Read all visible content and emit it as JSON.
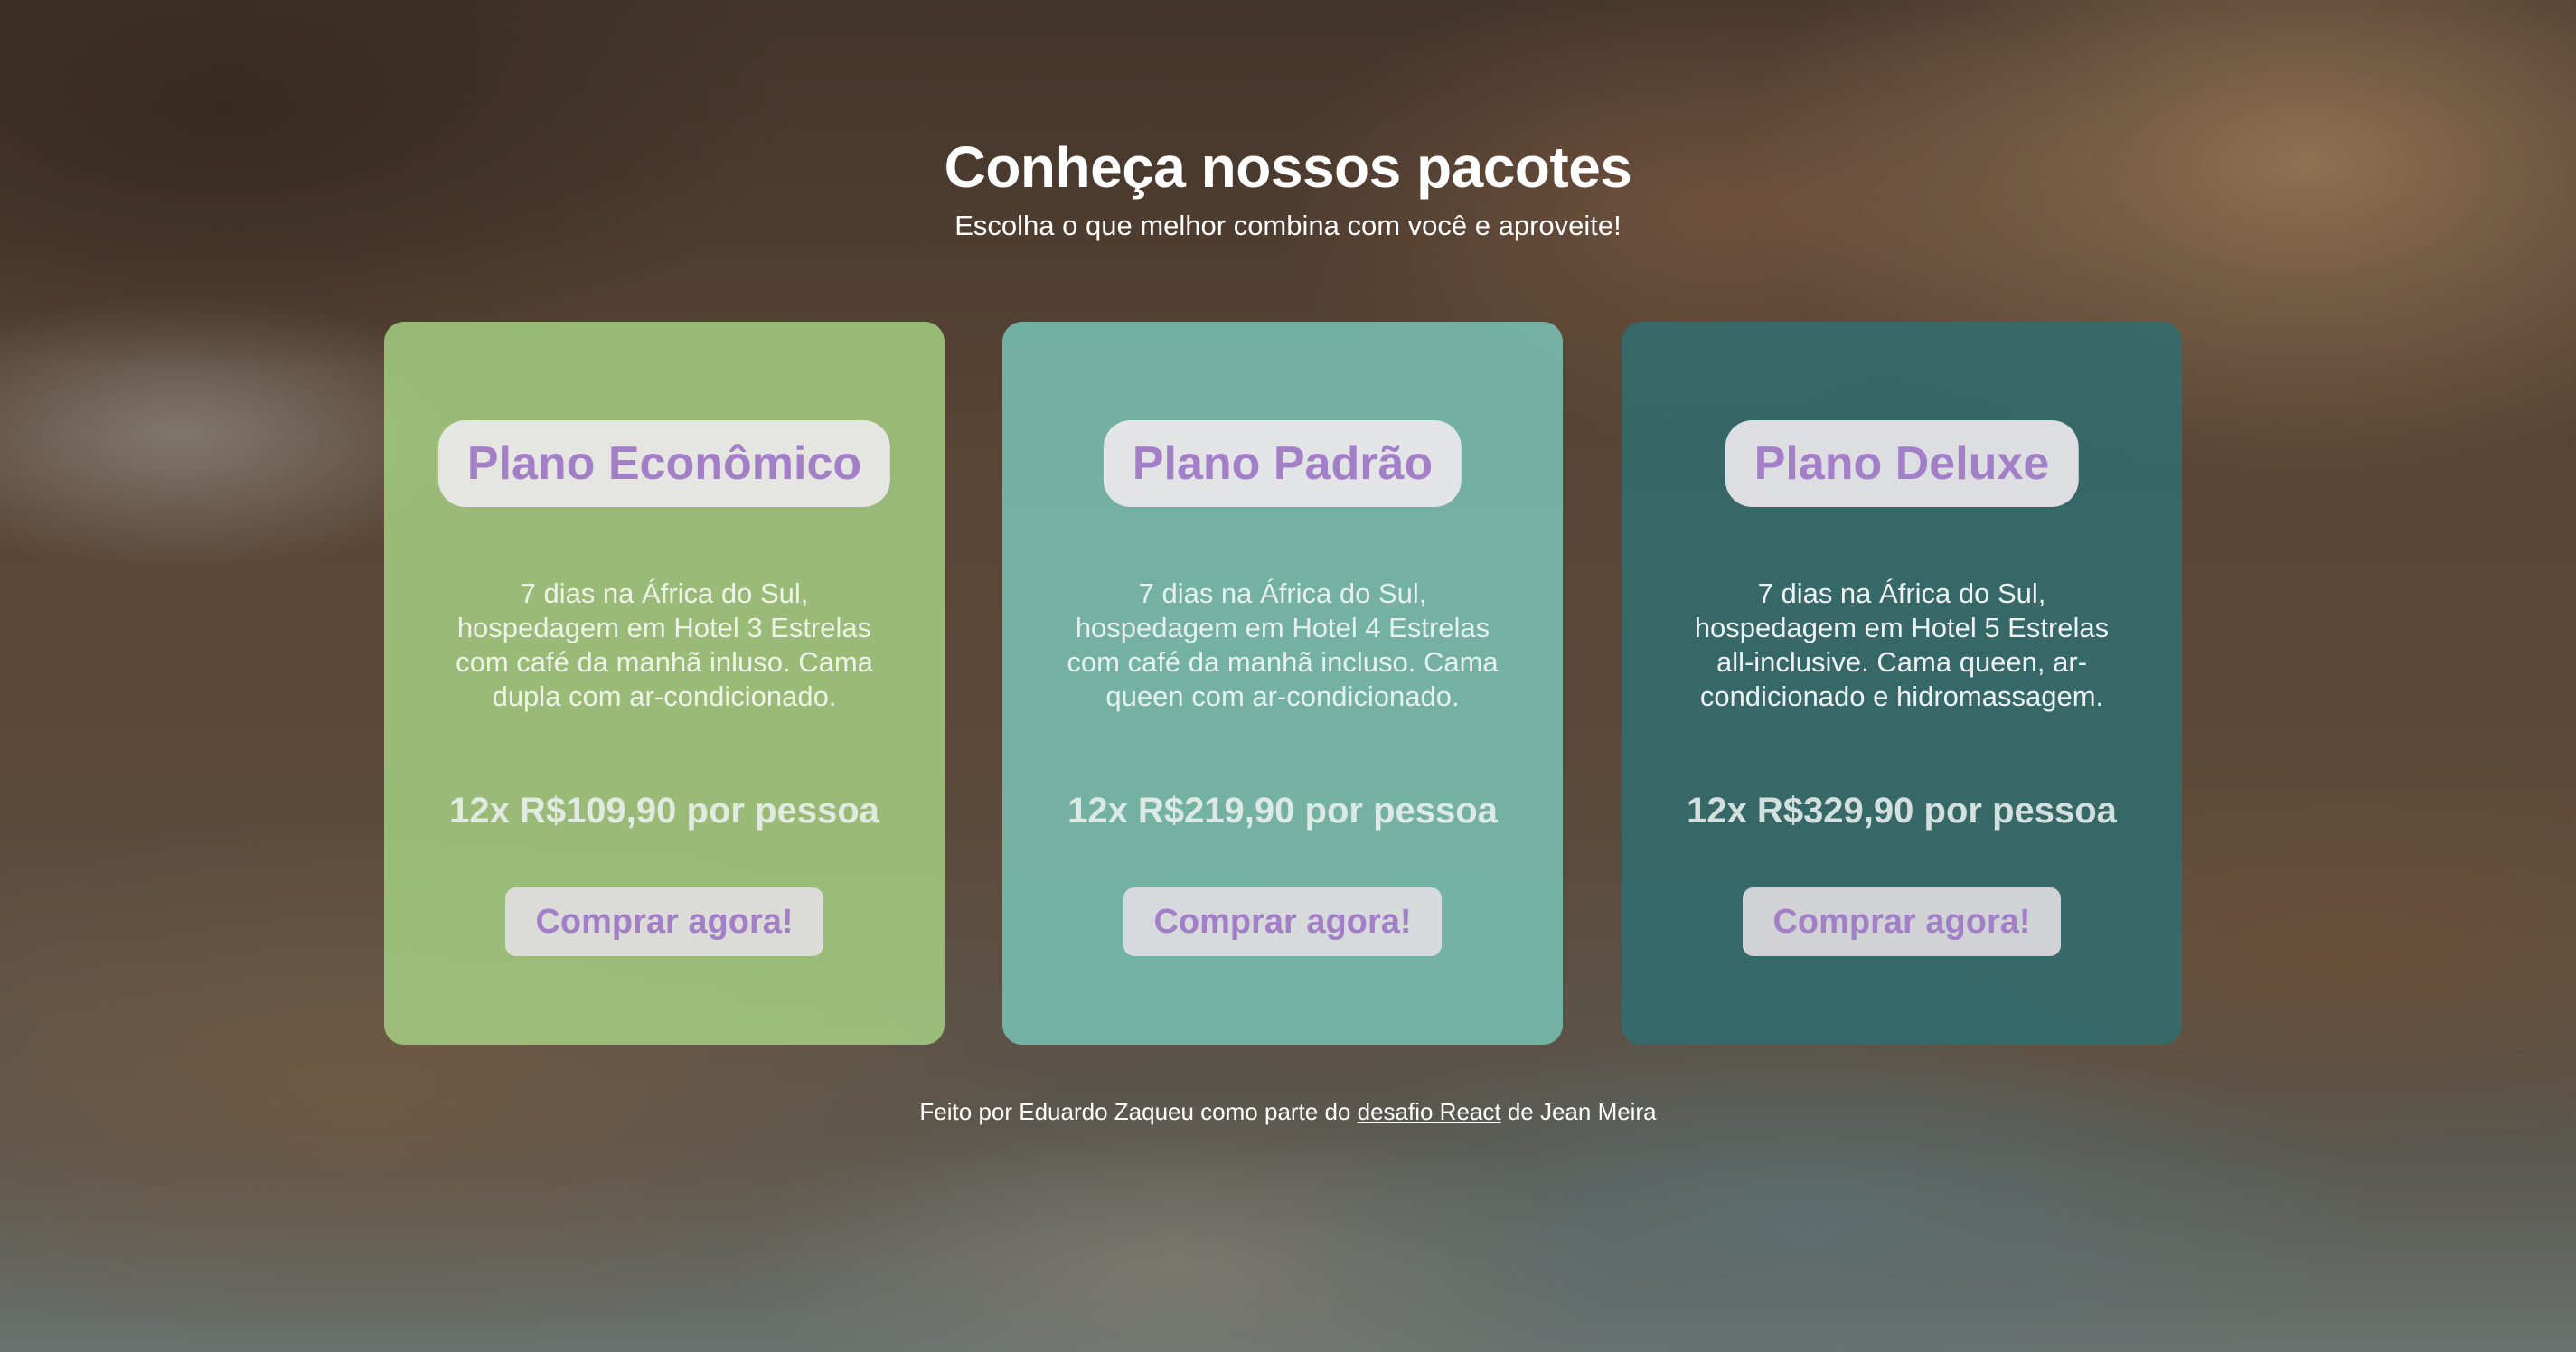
{
  "header": {
    "title": "Conheça nossos pacotes",
    "subtitle": "Escolha o que melhor combina com você e aproveite!"
  },
  "plans": [
    {
      "name": "Plano Econômico",
      "description": "7 dias na África do Sul, hospedagem em Hotel 3 Estrelas com café da manhã inluso. Cama dupla com ar-condicionado.",
      "price": "12x R$109,90 por pessoa",
      "button_label": "Comprar agora!",
      "card_color": "#a4ce82"
    },
    {
      "name": "Plano Padrão",
      "description": "7 dias na África do Sul, hospedagem em Hotel 4 Estrelas com café da manhã incluso. Cama queen com ar-condicionado.",
      "price": "12x R$219,90 por pessoa",
      "button_label": "Comprar agora!",
      "card_color": "#78c3b4"
    },
    {
      "name": "Plano Deluxe",
      "description": "7 dias na África do Sul, hospedagem em Hotel 5 Estrelas all-inclusive. Cama queen, ar-condicionado e hidromassagem.",
      "price": "12x R$329,90 por pessoa",
      "button_label": "Comprar agora!",
      "card_color": "#306e70"
    }
  ],
  "footer": {
    "text_before": "Feito por Eduardo Zaqueu como parte do ",
    "link_text": "desafio React",
    "text_after": " de Jean Meira"
  },
  "colors": {
    "accent": "#a27fc6",
    "pill_background": "#ece8ec"
  }
}
